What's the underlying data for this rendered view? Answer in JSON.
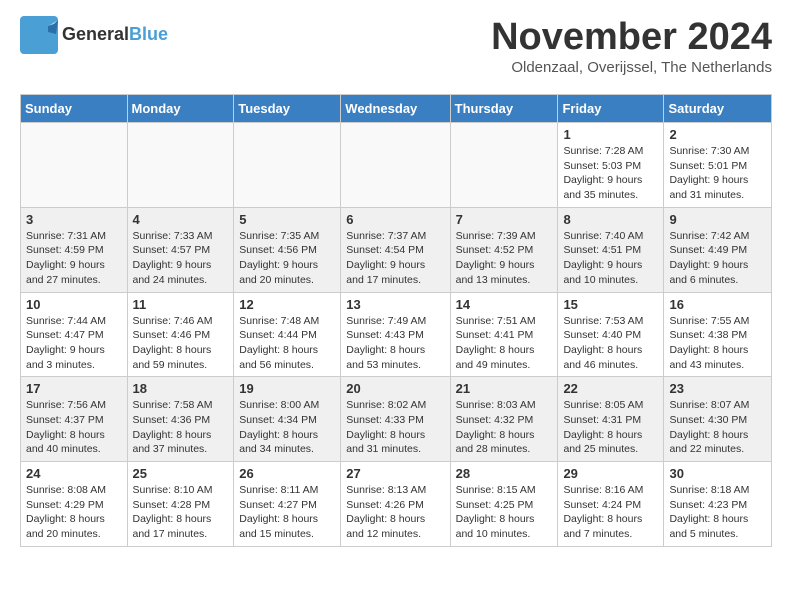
{
  "header": {
    "logo_general": "General",
    "logo_blue": "Blue",
    "month_title": "November 2024",
    "location": "Oldenzaal, Overijssel, The Netherlands"
  },
  "weekdays": [
    "Sunday",
    "Monday",
    "Tuesday",
    "Wednesday",
    "Thursday",
    "Friday",
    "Saturday"
  ],
  "weeks": [
    [
      {
        "day": "",
        "info": ""
      },
      {
        "day": "",
        "info": ""
      },
      {
        "day": "",
        "info": ""
      },
      {
        "day": "",
        "info": ""
      },
      {
        "day": "",
        "info": ""
      },
      {
        "day": "1",
        "info": "Sunrise: 7:28 AM\nSunset: 5:03 PM\nDaylight: 9 hours\nand 35 minutes."
      },
      {
        "day": "2",
        "info": "Sunrise: 7:30 AM\nSunset: 5:01 PM\nDaylight: 9 hours\nand 31 minutes."
      }
    ],
    [
      {
        "day": "3",
        "info": "Sunrise: 7:31 AM\nSunset: 4:59 PM\nDaylight: 9 hours\nand 27 minutes."
      },
      {
        "day": "4",
        "info": "Sunrise: 7:33 AM\nSunset: 4:57 PM\nDaylight: 9 hours\nand 24 minutes."
      },
      {
        "day": "5",
        "info": "Sunrise: 7:35 AM\nSunset: 4:56 PM\nDaylight: 9 hours\nand 20 minutes."
      },
      {
        "day": "6",
        "info": "Sunrise: 7:37 AM\nSunset: 4:54 PM\nDaylight: 9 hours\nand 17 minutes."
      },
      {
        "day": "7",
        "info": "Sunrise: 7:39 AM\nSunset: 4:52 PM\nDaylight: 9 hours\nand 13 minutes."
      },
      {
        "day": "8",
        "info": "Sunrise: 7:40 AM\nSunset: 4:51 PM\nDaylight: 9 hours\nand 10 minutes."
      },
      {
        "day": "9",
        "info": "Sunrise: 7:42 AM\nSunset: 4:49 PM\nDaylight: 9 hours\nand 6 minutes."
      }
    ],
    [
      {
        "day": "10",
        "info": "Sunrise: 7:44 AM\nSunset: 4:47 PM\nDaylight: 9 hours\nand 3 minutes."
      },
      {
        "day": "11",
        "info": "Sunrise: 7:46 AM\nSunset: 4:46 PM\nDaylight: 8 hours\nand 59 minutes."
      },
      {
        "day": "12",
        "info": "Sunrise: 7:48 AM\nSunset: 4:44 PM\nDaylight: 8 hours\nand 56 minutes."
      },
      {
        "day": "13",
        "info": "Sunrise: 7:49 AM\nSunset: 4:43 PM\nDaylight: 8 hours\nand 53 minutes."
      },
      {
        "day": "14",
        "info": "Sunrise: 7:51 AM\nSunset: 4:41 PM\nDaylight: 8 hours\nand 49 minutes."
      },
      {
        "day": "15",
        "info": "Sunrise: 7:53 AM\nSunset: 4:40 PM\nDaylight: 8 hours\nand 46 minutes."
      },
      {
        "day": "16",
        "info": "Sunrise: 7:55 AM\nSunset: 4:38 PM\nDaylight: 8 hours\nand 43 minutes."
      }
    ],
    [
      {
        "day": "17",
        "info": "Sunrise: 7:56 AM\nSunset: 4:37 PM\nDaylight: 8 hours\nand 40 minutes."
      },
      {
        "day": "18",
        "info": "Sunrise: 7:58 AM\nSunset: 4:36 PM\nDaylight: 8 hours\nand 37 minutes."
      },
      {
        "day": "19",
        "info": "Sunrise: 8:00 AM\nSunset: 4:34 PM\nDaylight: 8 hours\nand 34 minutes."
      },
      {
        "day": "20",
        "info": "Sunrise: 8:02 AM\nSunset: 4:33 PM\nDaylight: 8 hours\nand 31 minutes."
      },
      {
        "day": "21",
        "info": "Sunrise: 8:03 AM\nSunset: 4:32 PM\nDaylight: 8 hours\nand 28 minutes."
      },
      {
        "day": "22",
        "info": "Sunrise: 8:05 AM\nSunset: 4:31 PM\nDaylight: 8 hours\nand 25 minutes."
      },
      {
        "day": "23",
        "info": "Sunrise: 8:07 AM\nSunset: 4:30 PM\nDaylight: 8 hours\nand 22 minutes."
      }
    ],
    [
      {
        "day": "24",
        "info": "Sunrise: 8:08 AM\nSunset: 4:29 PM\nDaylight: 8 hours\nand 20 minutes."
      },
      {
        "day": "25",
        "info": "Sunrise: 8:10 AM\nSunset: 4:28 PM\nDaylight: 8 hours\nand 17 minutes."
      },
      {
        "day": "26",
        "info": "Sunrise: 8:11 AM\nSunset: 4:27 PM\nDaylight: 8 hours\nand 15 minutes."
      },
      {
        "day": "27",
        "info": "Sunrise: 8:13 AM\nSunset: 4:26 PM\nDaylight: 8 hours\nand 12 minutes."
      },
      {
        "day": "28",
        "info": "Sunrise: 8:15 AM\nSunset: 4:25 PM\nDaylight: 8 hours\nand 10 minutes."
      },
      {
        "day": "29",
        "info": "Sunrise: 8:16 AM\nSunset: 4:24 PM\nDaylight: 8 hours\nand 7 minutes."
      },
      {
        "day": "30",
        "info": "Sunrise: 8:18 AM\nSunset: 4:23 PM\nDaylight: 8 hours\nand 5 minutes."
      }
    ]
  ]
}
